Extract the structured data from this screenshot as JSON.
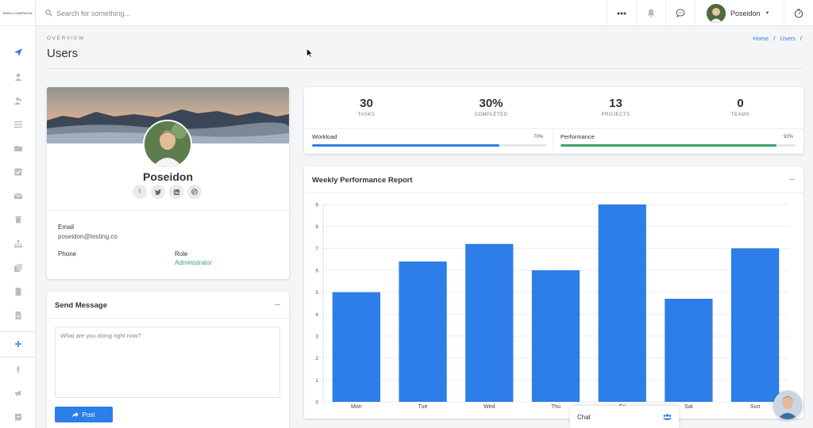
{
  "brand": {
    "logo_text": "SWELLCAMPAIGN"
  },
  "search": {
    "placeholder": "Search for something..."
  },
  "topbar": {
    "user_name": "Poseidon"
  },
  "page": {
    "section": "OVERVIEW",
    "title": "Users",
    "breadcrumb": {
      "home": "Home",
      "sep1": "/",
      "users": "Users",
      "sep2": "/"
    }
  },
  "profile": {
    "name": "Poseidon",
    "email_label": "Email",
    "email": "poseidon@testing.co",
    "phone_label": "Phone",
    "role_label": "Role",
    "role": "Administrator"
  },
  "message": {
    "title": "Send Message",
    "placeholder": "What are you doing right now?",
    "post_label": "Post"
  },
  "stats": {
    "items": [
      {
        "value": "30",
        "label": "TASKS"
      },
      {
        "value": "30%",
        "label": "COMPLETED"
      },
      {
        "value": "13",
        "label": "PROJECTS"
      },
      {
        "value": "0",
        "label": "TEAMS"
      }
    ],
    "workload": {
      "label": "Workload",
      "pct_text": "70%",
      "fraction": 0.8
    },
    "performance": {
      "label": "Performance",
      "pct_text": "92%",
      "fraction": 0.92
    }
  },
  "chart": {
    "title": "Weekly Performance Report"
  },
  "chat": {
    "label": "Chat"
  },
  "colors": {
    "accent": "#2d7ee8",
    "green": "#3aa56b",
    "bar": "#2d7ee8"
  },
  "chart_data": {
    "type": "bar",
    "title": "Weekly Performance Report",
    "categories": [
      "Mon",
      "Tue",
      "Wed",
      "Thu",
      "Fri",
      "Sat",
      "Sun"
    ],
    "values": [
      5.0,
      6.4,
      7.2,
      6.0,
      9.0,
      4.7,
      7.0
    ],
    "ylim": [
      0,
      9
    ],
    "yticks": [
      "0",
      "1",
      "2",
      "3",
      "4",
      "5",
      "6",
      "7",
      "8",
      "9"
    ],
    "grid": true,
    "legend": "none"
  }
}
